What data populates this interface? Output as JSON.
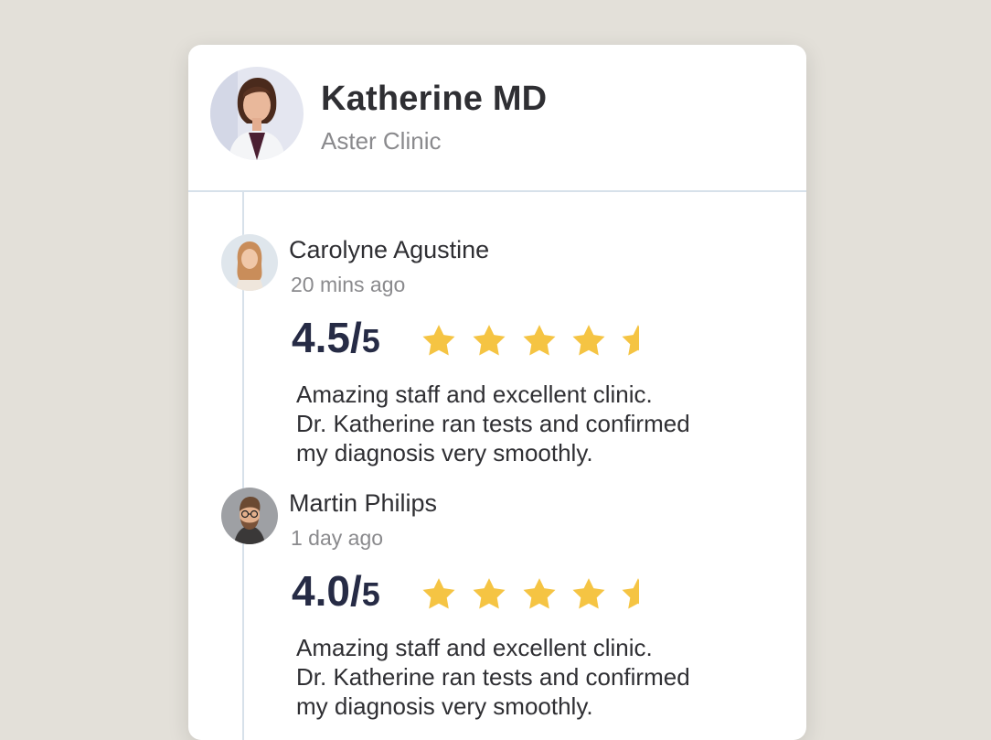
{
  "doctor": {
    "name": "Katherine MD",
    "clinic": "Aster Clinic"
  },
  "reviews": [
    {
      "name": "Carolyne Agustine",
      "time": "20 mins ago",
      "score": "4.5",
      "slash": "/",
      "max": "5",
      "rating_value": 4.5,
      "text_lines": [
        "Amazing staff and excellent clinic.",
        "Dr. Katherine ran tests and confirmed",
        "my diagnosis very smoothly."
      ]
    },
    {
      "name": "Martin Philips",
      "time": "1 day ago",
      "score": "4.0",
      "slash": "/",
      "max": "5",
      "rating_value": 4.0,
      "text_lines": [
        "Amazing staff and excellent clinic.",
        "Dr. Katherine ran tests and confirmed",
        "my diagnosis very smoothly."
      ]
    }
  ],
  "colors": {
    "star": "#f5c443",
    "score": "#262b45",
    "divider": "#d7e1ea",
    "background": "#e3e0d9"
  }
}
